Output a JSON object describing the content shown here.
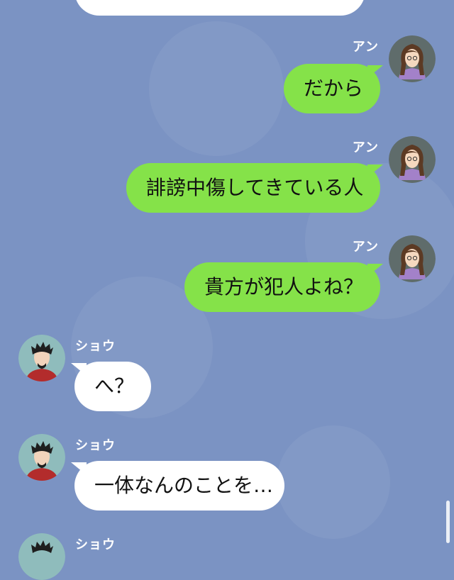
{
  "messages": [
    {
      "sender": "アン",
      "text": "だから",
      "side": "right"
    },
    {
      "sender": "アン",
      "text": "誹謗中傷してきている人",
      "side": "right"
    },
    {
      "sender": "アン",
      "text": "貴方が犯人よね？",
      "side": "right"
    },
    {
      "sender": "ショウ",
      "text": "へ？",
      "side": "left"
    },
    {
      "sender": "ショウ",
      "text": "一体なんのことを…",
      "side": "left"
    },
    {
      "sender": "ショウ",
      "side": "left"
    }
  ],
  "colors": {
    "background": "#7b93c3",
    "sent_bubble": "#85e249",
    "received_bubble": "#ffffff"
  }
}
